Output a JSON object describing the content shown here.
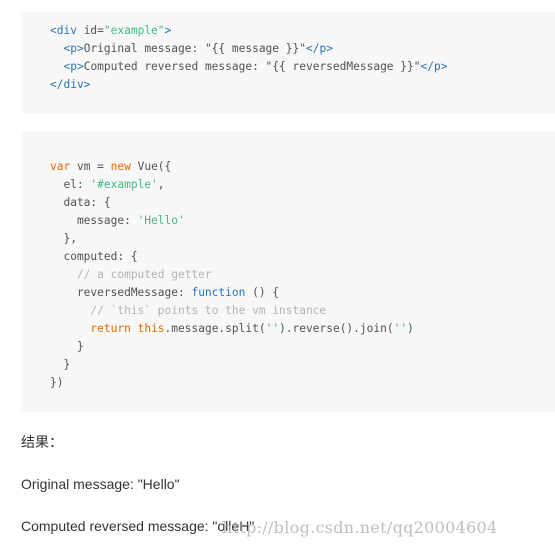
{
  "html_code": [
    [
      [
        "tag",
        "<div "
      ],
      [
        "txt",
        "id="
      ],
      [
        "str",
        "\"example\""
      ],
      [
        "tag",
        ">"
      ]
    ],
    [
      [
        "txt",
        "  "
      ],
      [
        "tag",
        "<p>"
      ],
      [
        "txt",
        "Original message: \"{{ message }}\""
      ],
      [
        "tag",
        "</p>"
      ]
    ],
    [
      [
        "txt",
        "  "
      ],
      [
        "tag",
        "<p>"
      ],
      [
        "txt",
        "Computed reversed message: \"{{ reversedMessage }}\""
      ],
      [
        "tag",
        "</p>"
      ]
    ],
    [
      [
        "tag",
        "</div>"
      ]
    ]
  ],
  "js_code": [
    [
      [
        "kw",
        "var"
      ],
      [
        "txt",
        " vm = "
      ],
      [
        "kw",
        "new"
      ],
      [
        "txt",
        " Vue({"
      ]
    ],
    [
      [
        "txt",
        "  el: "
      ],
      [
        "str",
        "'#example'"
      ],
      [
        "txt",
        ","
      ]
    ],
    [
      [
        "txt",
        "  data: {"
      ]
    ],
    [
      [
        "txt",
        "    message: "
      ],
      [
        "str",
        "'Hello'"
      ]
    ],
    [
      [
        "txt",
        "  },"
      ]
    ],
    [
      [
        "txt",
        "  computed: {"
      ]
    ],
    [
      [
        "com",
        "    // a computed getter"
      ]
    ],
    [
      [
        "txt",
        "    reversedMessage: "
      ],
      [
        "fn",
        "function"
      ],
      [
        "txt",
        " () {"
      ]
    ],
    [
      [
        "com",
        "      // `this` points to the vm instance"
      ]
    ],
    [
      [
        "txt",
        "      "
      ],
      [
        "kw",
        "return"
      ],
      [
        "txt",
        " "
      ],
      [
        "kw",
        "this"
      ],
      [
        "txt",
        ".message.split("
      ],
      [
        "str",
        "''"
      ],
      [
        "txt",
        ").reverse().join("
      ],
      [
        "str",
        "''"
      ],
      [
        "txt",
        ")"
      ]
    ],
    [
      [
        "txt",
        "    }"
      ]
    ],
    [
      [
        "txt",
        "  }"
      ]
    ],
    [
      [
        "txt",
        "})"
      ]
    ]
  ],
  "result": {
    "label": "结果：",
    "original": "Original message: \"Hello\"",
    "computed": "Computed reversed message: \"olleH\""
  },
  "watermark": "http://blog.csdn.net/qq20004604",
  "colors": {
    "tag": "#2973b7",
    "string": "#42b983",
    "keyword": "#e96900",
    "comment": "#b3b3b3",
    "text": "#525252",
    "code_bg": "#f8f8f8"
  }
}
